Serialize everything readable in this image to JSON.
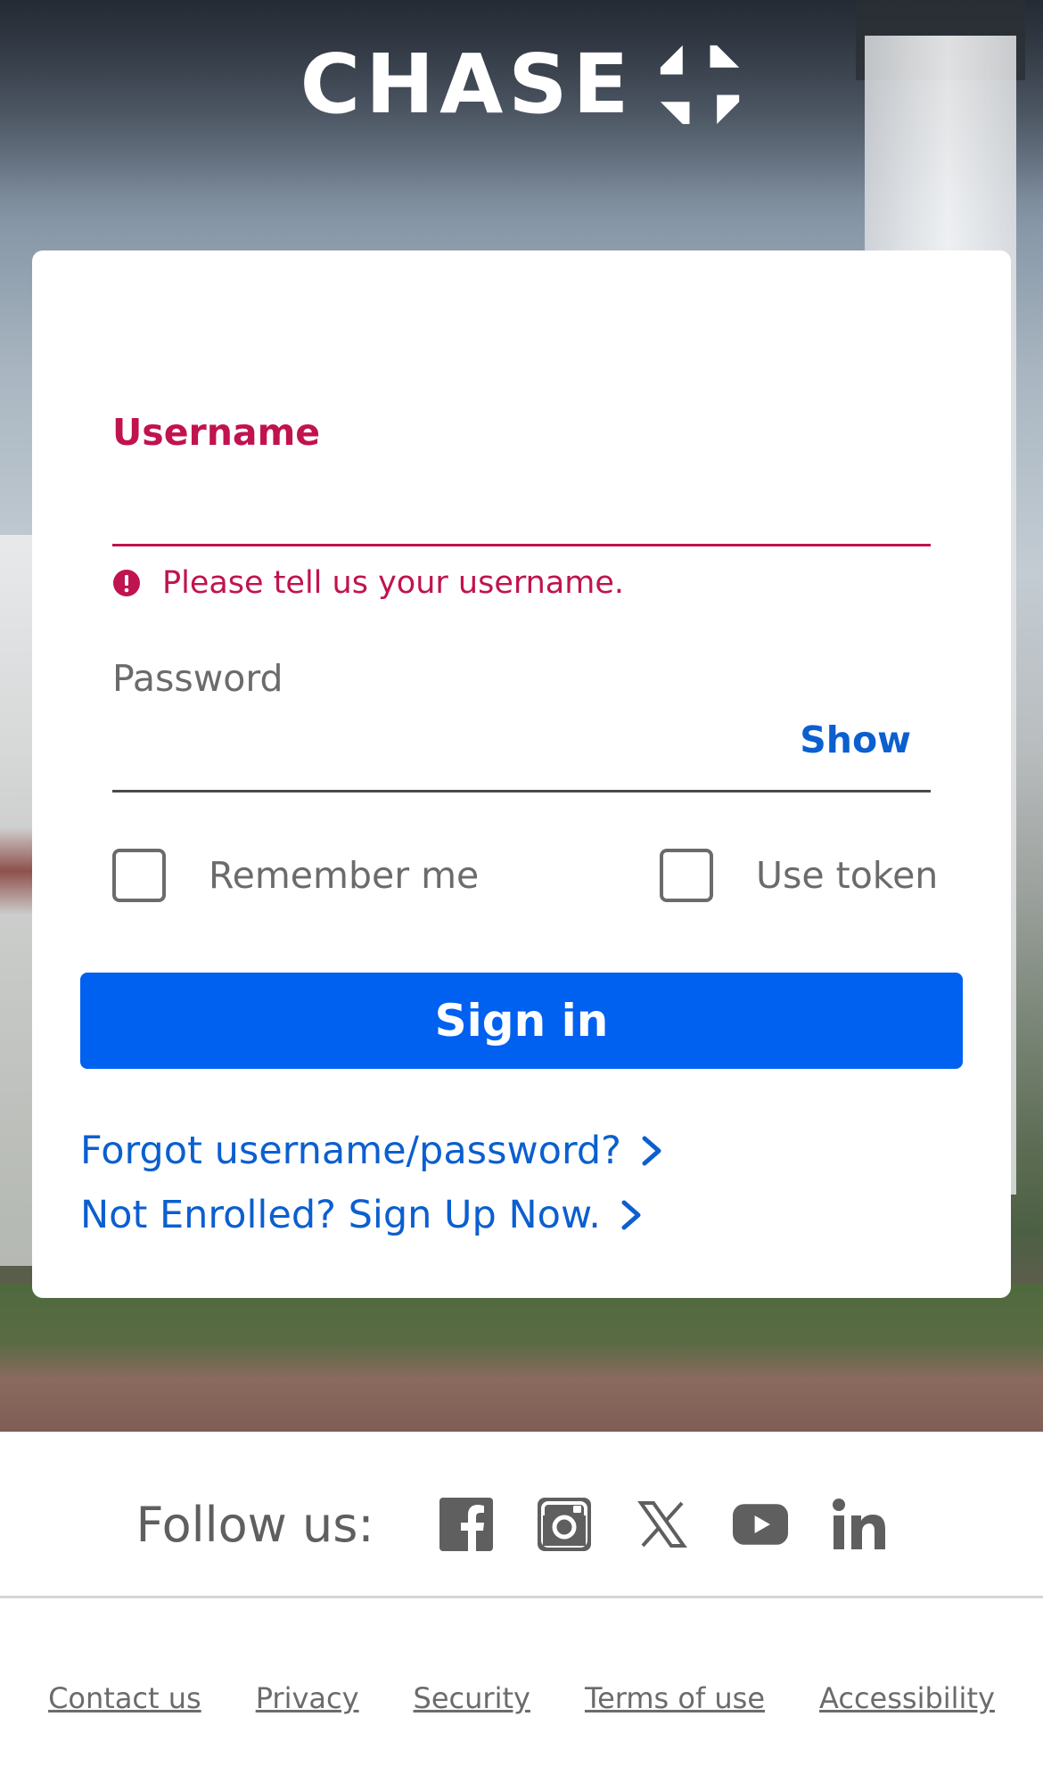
{
  "brand": {
    "name": "CHASE"
  },
  "login": {
    "username_label": "Username",
    "username_error": "Please tell us your username.",
    "password_label": "Password",
    "show_label": "Show",
    "remember_label": "Remember me",
    "token_label": "Use token",
    "signin_label": "Sign in",
    "forgot_link": "Forgot username/password?",
    "enroll_link": "Not Enrolled? Sign Up Now."
  },
  "social": {
    "follow_label": "Follow us:",
    "icons": [
      "facebook-icon",
      "instagram-icon",
      "x-icon",
      "youtube-icon",
      "linkedin-icon"
    ]
  },
  "footer": {
    "links": [
      "Contact us",
      "Privacy",
      "Security",
      "Terms of use",
      "Accessibility"
    ]
  },
  "colors": {
    "error": "#c0134f",
    "primary": "#0060f0",
    "link": "#0b5fcf"
  }
}
